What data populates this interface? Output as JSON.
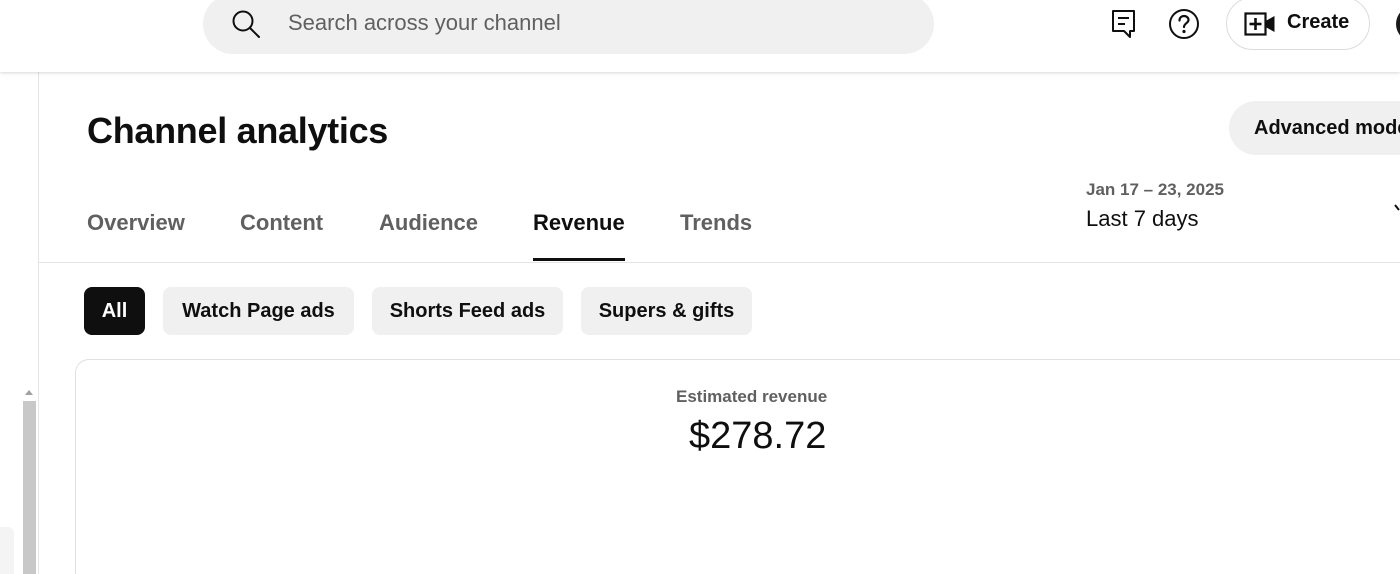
{
  "search": {
    "placeholder": "Search across your channel"
  },
  "header": {
    "create_label": "Create",
    "icons": [
      "search-icon",
      "feedback-icon",
      "help-icon",
      "create-video-icon"
    ]
  },
  "page": {
    "title": "Channel analytics",
    "advanced_mode_label": "Advanced mode"
  },
  "tabs": [
    {
      "label": "Overview",
      "active": false
    },
    {
      "label": "Content",
      "active": false
    },
    {
      "label": "Audience",
      "active": false
    },
    {
      "label": "Revenue",
      "active": true
    },
    {
      "label": "Trends",
      "active": false
    }
  ],
  "date_range": {
    "dates": "Jan 17 – 23, 2025",
    "label": "Last 7 days"
  },
  "filters": [
    {
      "label": "All",
      "selected": true
    },
    {
      "label": "Watch Page ads",
      "selected": false
    },
    {
      "label": "Shorts Feed ads",
      "selected": false
    },
    {
      "label": "Supers & gifts",
      "selected": false
    }
  ],
  "metric": {
    "label": "Estimated revenue",
    "value": "$278.72"
  },
  "colors": {
    "accent_text": "#0f0f0f",
    "muted_text": "#606060",
    "chip_bg": "#f0f0f0",
    "chip_selected_bg": "#0f0f0f"
  }
}
